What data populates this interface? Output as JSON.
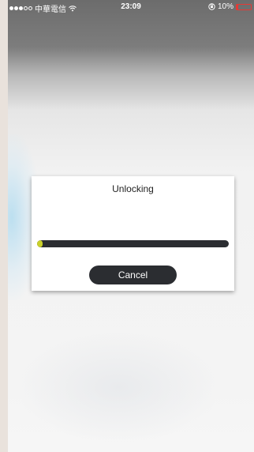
{
  "status_bar": {
    "carrier": "中華電信",
    "signal_bars": 3,
    "signal_max": 5,
    "time": "23:09",
    "battery_percent": "10%",
    "battery_level": 0.1,
    "battery_color": "#e53935"
  },
  "dialog": {
    "title": "Unlocking",
    "progress": 0.02,
    "progress_color": "#c9d02a",
    "cancel_label": "Cancel"
  }
}
